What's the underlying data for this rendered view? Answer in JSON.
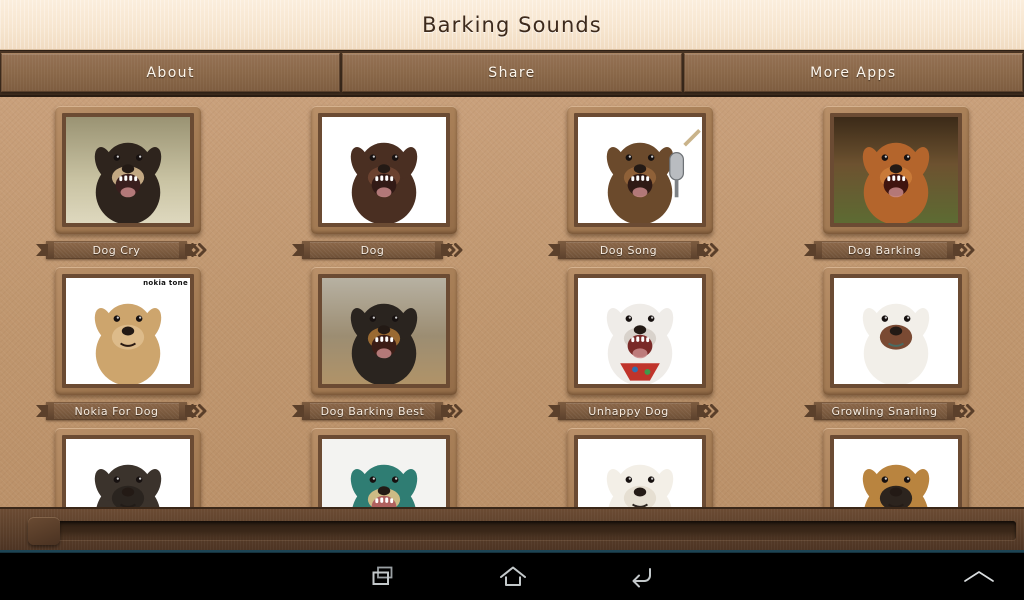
{
  "app": {
    "title": "Barking Sounds",
    "accent_brown": "#8a6849",
    "background_tan": "#c39a76",
    "header_cream": "#f7e6d0"
  },
  "tabs": [
    {
      "label": "About",
      "name": "tab-about"
    },
    {
      "label": "Share",
      "name": "tab-share"
    },
    {
      "label": "More Apps",
      "name": "tab-more-apps"
    }
  ],
  "sounds": [
    {
      "label": "Dog Cry",
      "row": 1,
      "col": 1,
      "thumb": "dog-cry"
    },
    {
      "label": "Dog",
      "row": 1,
      "col": 2,
      "thumb": "dog"
    },
    {
      "label": "Dog Song",
      "row": 1,
      "col": 3,
      "thumb": "dog-song"
    },
    {
      "label": "Dog Barking",
      "row": 1,
      "col": 4,
      "thumb": "dog-barking"
    },
    {
      "label": "Nokia For Dog",
      "row": 2,
      "col": 1,
      "thumb": "nokia-for-dog",
      "overlay_text": "nokia tone"
    },
    {
      "label": "Dog Barking Best",
      "row": 2,
      "col": 2,
      "thumb": "dog-barking-best"
    },
    {
      "label": "Unhappy Dog",
      "row": 2,
      "col": 3,
      "thumb": "unhappy-dog"
    },
    {
      "label": "Growling Snarling",
      "row": 2,
      "col": 4,
      "thumb": "growling-snarling"
    },
    {
      "label": "",
      "row": 3,
      "col": 1,
      "thumb": "dark-pug"
    },
    {
      "label": "",
      "row": 3,
      "col": 2,
      "thumb": "teal-barking-dog"
    },
    {
      "label": "",
      "row": 3,
      "col": 3,
      "thumb": "white-puppy"
    },
    {
      "label": "",
      "row": 3,
      "col": 4,
      "thumb": "german-shepherd"
    }
  ],
  "scrollbar": {
    "orientation": "horizontal",
    "thumb_position": "left"
  },
  "navbar": {
    "buttons": [
      {
        "name": "nav-recent-apps",
        "icon": "recent-apps-icon"
      },
      {
        "name": "nav-home",
        "icon": "home-icon"
      },
      {
        "name": "nav-back",
        "icon": "back-icon"
      },
      {
        "name": "nav-expand",
        "icon": "chevron-up-icon"
      }
    ]
  }
}
